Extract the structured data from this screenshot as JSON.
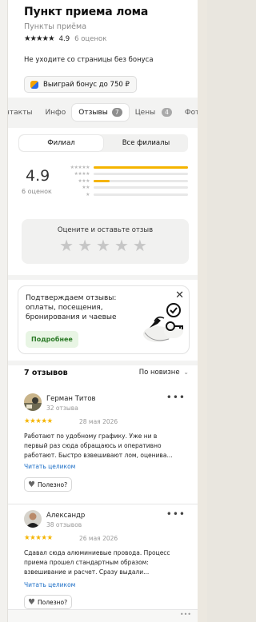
{
  "place": {
    "title": "Пункт приема лома",
    "category": "Пункты приёма",
    "rating": "4.9",
    "reviews_count": "6 оценок",
    "stars": "★★★★★"
  },
  "bonus": {
    "text": "Не уходите со страницы без бонуса",
    "button": "Выиграй бонус до 750 ₽"
  },
  "tabs": [
    {
      "label": "нтакты"
    },
    {
      "label": "Инфо"
    },
    {
      "label": "Отзывы",
      "badge": "7"
    },
    {
      "label": "Цены",
      "badge": "4"
    },
    {
      "label": "Фот"
    }
  ],
  "filter": {
    "branch": "Филиал",
    "all": "Все филиалы"
  },
  "summary": {
    "rating": "4.9",
    "count": "6 оценок",
    "distribution": [
      {
        "stars": "★★★★★",
        "fraction": 1.0
      },
      {
        "stars": "★★★★",
        "fraction": 0.0
      },
      {
        "stars": "★★★",
        "fraction": 0.17
      },
      {
        "stars": "★★",
        "fraction": 0.0
      },
      {
        "stars": "★",
        "fraction": 0.0
      }
    ]
  },
  "rate_card": {
    "label": "Оцените и оставьте отзыв",
    "stars": "★★★★★"
  },
  "promo": {
    "text": "Подтверждаем отзывы: оплаты, посещения, бронирования и чаевые",
    "button": "Подробнее",
    "close": "✕"
  },
  "reviews_header": {
    "title": "7 отзывов",
    "sort": "По новизне",
    "sort_icon": "⌄"
  },
  "reviews": [
    {
      "name": "Герман Титов",
      "count": "32 отзыва",
      "stars": "★★★★★",
      "date": "28 мая 2026",
      "text": "Работают по удобному графику. Уже ни в первый раз сюда обращаюсь и оперативно работают. Быстро взвешивают лом, оценива...",
      "read_more": "Читать целиком",
      "useful": "Полезно?",
      "more": "•••"
    },
    {
      "name": "Александр",
      "count": "38 отзывов",
      "stars": "★★★★★",
      "date": "26 мая 2026",
      "text": "Сдавал сюда алюминиевые провода. Процесс приема прошел стандартным образом: взвешивание и расчет. Сразу выдали...",
      "read_more": "Читать целиком",
      "useful": "Полезно?",
      "more": "•••"
    }
  ],
  "footer": {
    "dots": "•••"
  },
  "colors": {
    "accent_star": "#f5b400",
    "link": "#1a6dc6",
    "promo_green": "#2b7a27"
  }
}
